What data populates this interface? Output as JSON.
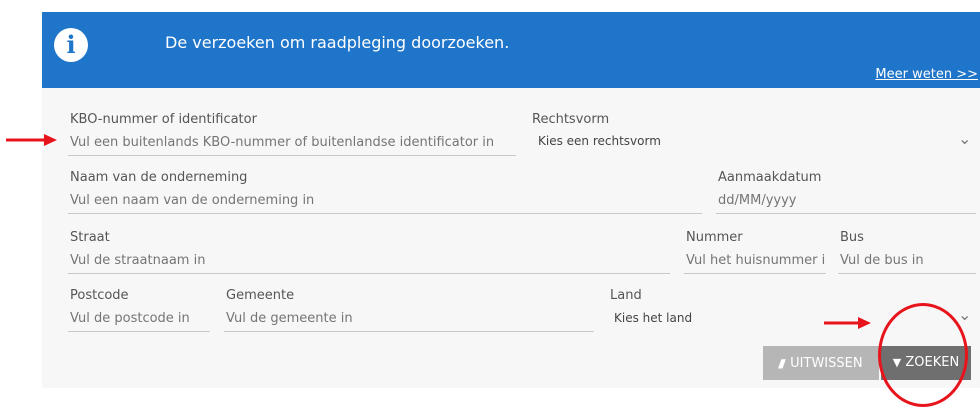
{
  "banner": {
    "text": "De verzoeken om raadpleging doorzoeken.",
    "more_link": "Meer weten >>",
    "icon": "info-icon"
  },
  "form": {
    "kbo": {
      "label": "KBO-nummer of identificator",
      "placeholder": "Vul een buitenlands KBO-nummer of buitenlandse identificator in"
    },
    "rechtsvorm": {
      "label": "Rechtsvorm",
      "selected": "Kies een rechtsvorm"
    },
    "naam": {
      "label": "Naam van de onderneming",
      "placeholder": "Vul een naam van de onderneming in"
    },
    "aanmaakdatum": {
      "label": "Aanmaakdatum",
      "placeholder": "dd/MM/yyyy"
    },
    "straat": {
      "label": "Straat",
      "placeholder": "Vul de straatnaam in"
    },
    "nummer": {
      "label": "Nummer",
      "placeholder": "Vul het huisnummer in"
    },
    "bus": {
      "label": "Bus",
      "placeholder": "Vul de bus in"
    },
    "postcode": {
      "label": "Postcode",
      "placeholder": "Vul de postcode in"
    },
    "gemeente": {
      "label": "Gemeente",
      "placeholder": "Vul de gemeente in"
    },
    "land": {
      "label": "Land",
      "selected": "Kies het land"
    }
  },
  "buttons": {
    "clear_label": "UITWISSEN",
    "search_label": "ZOEKEN"
  },
  "colors": {
    "banner": "#1f75c9",
    "annotation": "#e8141c",
    "clear_button": "#b6b6b6",
    "search_button": "#6f6f6f"
  }
}
